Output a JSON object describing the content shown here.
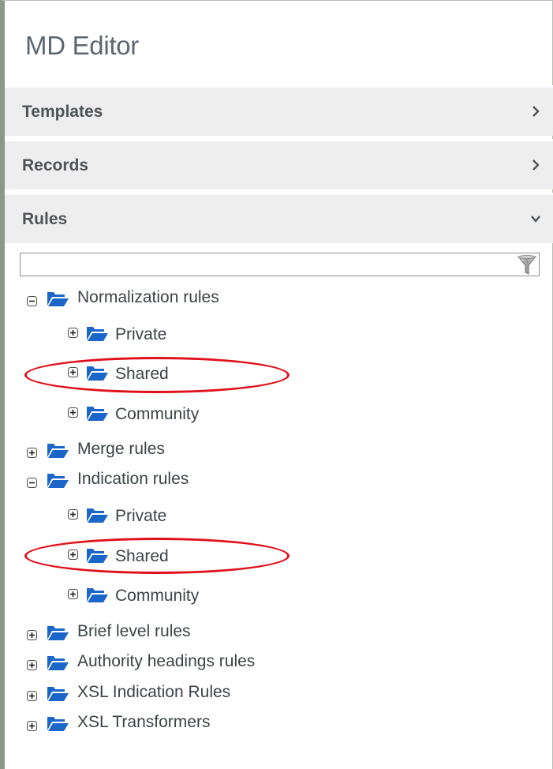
{
  "app": {
    "title": "MD Editor"
  },
  "sections": [
    {
      "label": "Templates",
      "state": "collapsed",
      "icon": "chevron-right-icon"
    },
    {
      "label": "Records",
      "state": "collapsed",
      "icon": "chevron-right-icon"
    },
    {
      "label": "Rules",
      "state": "expanded",
      "icon": "chevron-down-icon"
    }
  ],
  "filter": {
    "value": "",
    "placeholder": "",
    "icon": "filter-icon"
  },
  "tree": [
    {
      "label": "Normalization rules",
      "expanded": true,
      "children": [
        {
          "label": "Private"
        },
        {
          "label": "Shared",
          "highlighted": true
        },
        {
          "label": "Community"
        }
      ]
    },
    {
      "label": "Merge rules",
      "expanded": false
    },
    {
      "label": "Indication rules",
      "expanded": true,
      "children": [
        {
          "label": "Private"
        },
        {
          "label": "Shared",
          "highlighted": true
        },
        {
          "label": "Community"
        }
      ]
    },
    {
      "label": "Brief level rules",
      "expanded": false
    },
    {
      "label": "Authority headings rules",
      "expanded": false
    },
    {
      "label": "XSL Indication Rules",
      "expanded": false
    },
    {
      "label": "XSL Transformers",
      "expanded": false
    }
  ],
  "colors": {
    "folder": "#1b66c9",
    "highlight": "#e0101a",
    "section_bg": "#eeeeee",
    "text": "#3d4248"
  }
}
